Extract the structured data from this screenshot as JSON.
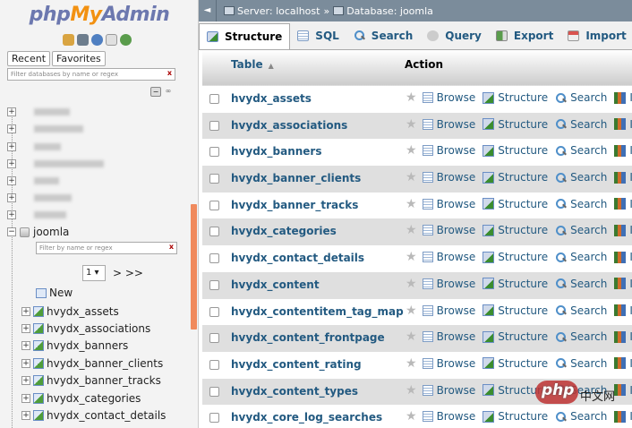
{
  "logo": {
    "php": "php",
    "my": "My",
    "admin": "Admin"
  },
  "nav_tabs": [
    "Recent",
    "Favorites"
  ],
  "nav_filter_placeholder": "Filter databases by name or regex",
  "nav_filter_clear": "x",
  "db": {
    "name": "joomla",
    "filter_placeholder": "Filter by name or regex",
    "filter_clear": "x",
    "page": "1",
    "next": "> >>",
    "new_label": "New"
  },
  "nav_tables": [
    "hvydx_assets",
    "hvydx_associations",
    "hvydx_banners",
    "hvydx_banner_clients",
    "hvydx_banner_tracks",
    "hvydx_categories",
    "hvydx_contact_details"
  ],
  "breadcrumb": {
    "server": "Server: localhost",
    "sep": "»",
    "database": "Database: joomla"
  },
  "tabs": [
    "Structure",
    "SQL",
    "Search",
    "Query",
    "Export",
    "Import"
  ],
  "table_header": {
    "table": "Table",
    "sort": "▲",
    "action": "Action"
  },
  "rows": [
    "hvydx_assets",
    "hvydx_associations",
    "hvydx_banners",
    "hvydx_banner_clients",
    "hvydx_banner_tracks",
    "hvydx_categories",
    "hvydx_contact_details",
    "hvydx_content",
    "hvydx_contentitem_tag_map",
    "hvydx_content_frontpage",
    "hvydx_content_rating",
    "hvydx_content_types",
    "hvydx_core_log_searches"
  ],
  "actions": {
    "star": "★",
    "browse": "Browse",
    "structure": "Structure",
    "search": "Search",
    "insert": "Ins"
  },
  "watermark": {
    "text": "php",
    "suffix": "中文网"
  },
  "colors": {
    "link": "#235a81",
    "breadcrumb_bg": "#7b8c9b",
    "row_alt": "#dfdfdf",
    "scrollbar": "#f08a5d"
  }
}
